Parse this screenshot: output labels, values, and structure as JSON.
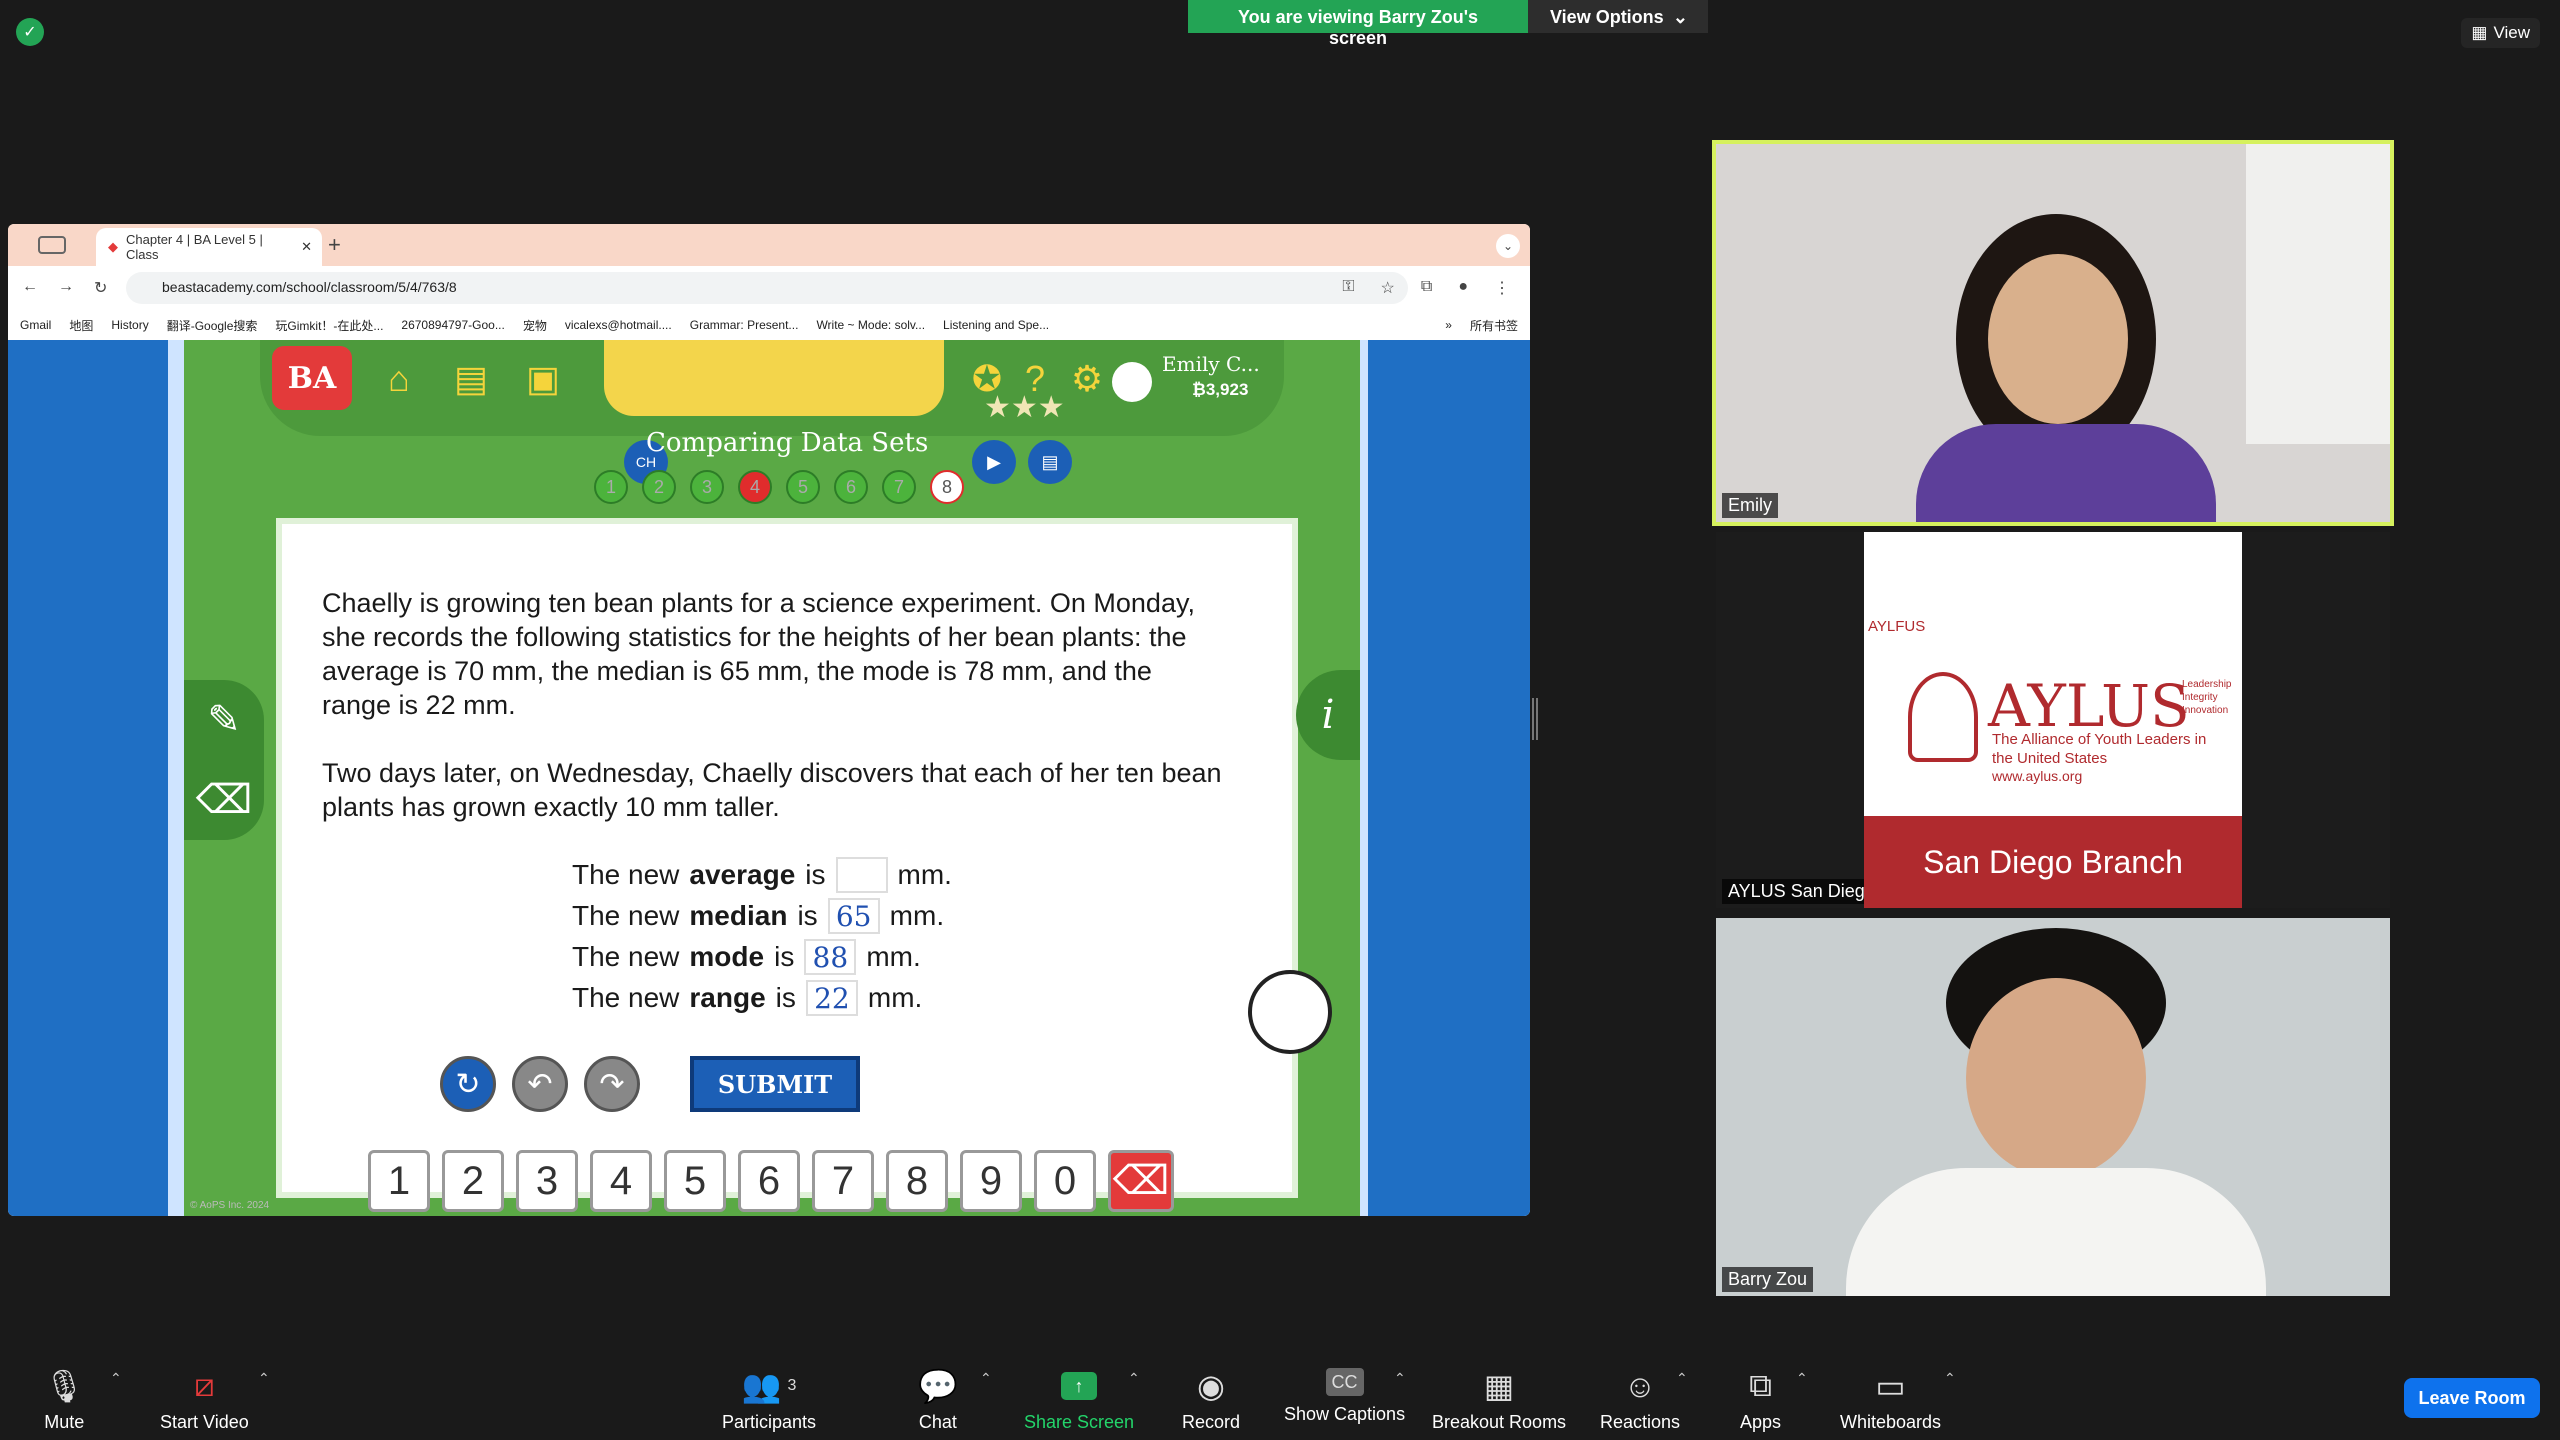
{
  "meeting": {
    "viewing_banner": "You are viewing Barry Zou's screen",
    "view_options": "View Options",
    "view_top": "View"
  },
  "browser": {
    "tab_title": "Chapter 4 | BA Level 5 | Class",
    "url": "beastacademy.com/school/classroom/5/4/763/8",
    "bookmarks": [
      "Gmail",
      "地图",
      "History",
      "翻译-Google搜索",
      "玩Gimkit！-在此处...",
      "2670894797-Goo...",
      "宠物",
      "vicalexs@hotmail....",
      "Grammar: Present...",
      "Write ~ Mode: solv...",
      "Listening and Spe..."
    ],
    "bookmarks_more": "»",
    "all_bookmarks": "所有书签"
  },
  "beast_academy": {
    "logo": "BA",
    "lesson_title": "Comparing Data Sets",
    "user_name": "Emily C...",
    "user_coins": "₿3,923",
    "problem_numbers": [
      "1",
      "2",
      "3",
      "4",
      "5",
      "6",
      "7",
      "8"
    ],
    "problem_paragraph_1": "Chaelly is growing ten bean plants for a science experiment. On Monday, she records the following statistics for the heights of her bean plants: the average is 70 mm, the median is 65 mm, the mode is 78 mm, and the range is 22 mm.",
    "problem_paragraph_2": "Two days later, on Wednesday, Chaelly discovers that each of her ten bean plants has grown exactly 10 mm taller.",
    "answers": [
      {
        "prefix": "The new",
        "term": "average",
        "is": "is",
        "value": "",
        "unit": "mm."
      },
      {
        "prefix": "The new",
        "term": "median",
        "is": "is",
        "value": "65",
        "unit": "mm."
      },
      {
        "prefix": "The new",
        "term": "mode",
        "is": "is",
        "value": "88",
        "unit": "mm."
      },
      {
        "prefix": "The new",
        "term": "range",
        "is": "is",
        "value": "22",
        "unit": "mm."
      }
    ],
    "submit": "SUBMIT",
    "numpad": [
      "1",
      "2",
      "3",
      "4",
      "5",
      "6",
      "7",
      "8",
      "9",
      "0"
    ],
    "copyright": "© AoPS Inc. 2024",
    "info": "i"
  },
  "participants": [
    {
      "name": "Emily"
    },
    {
      "name": "AYLUS San Diego"
    },
    {
      "name": "Barry Zou"
    }
  ],
  "aylus": {
    "small": "AYLFUS",
    "big": "AYLUS",
    "tagline_right": "Leadership Integrity Innovation",
    "subtitle": "The Alliance of Youth Leaders in the United States",
    "url": "www.aylus.org",
    "banner": "San Diego Branch"
  },
  "toolbar": {
    "mute": "Mute",
    "start_video": "Start Video",
    "participants": "Participants",
    "participants_count": "3",
    "chat": "Chat",
    "share_screen": "Share Screen",
    "record": "Record",
    "show_captions": "Show Captions",
    "breakout_rooms": "Breakout Rooms",
    "reactions": "Reactions",
    "apps": "Apps",
    "whiteboards": "Whiteboards",
    "leave": "Leave Room"
  },
  "colors": {
    "zoom_green": "#23a455",
    "leave_blue": "#0e72ed",
    "active_speaker": "#d6f15e",
    "ba_red": "#e33a3a"
  }
}
